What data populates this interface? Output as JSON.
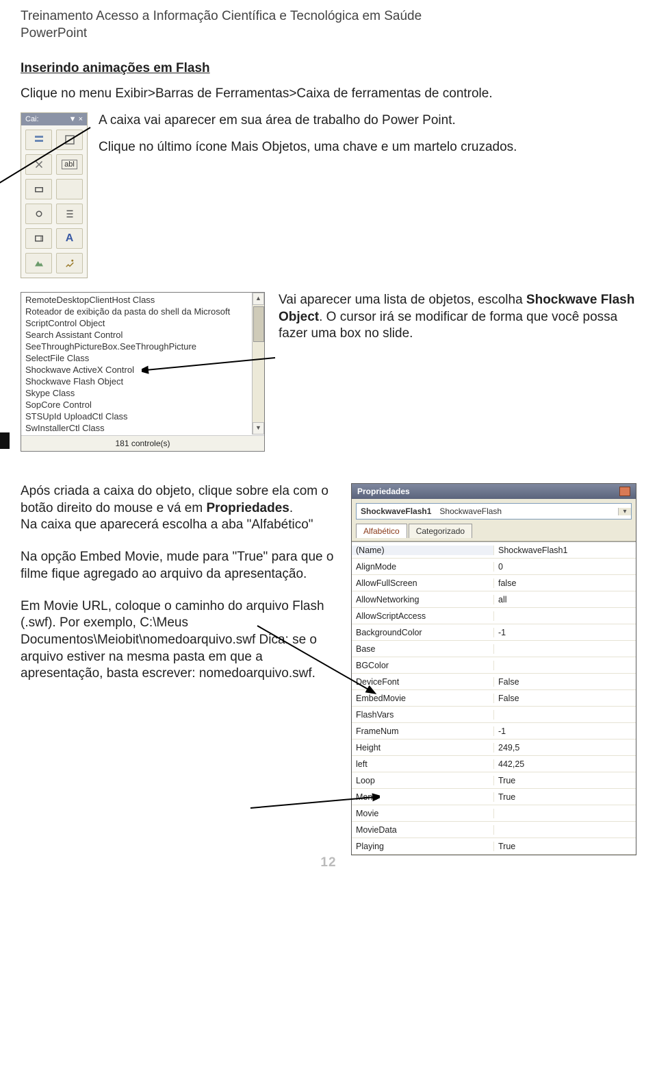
{
  "header": {
    "line1": "Treinamento Acesso a Informação Científica e Tecnológica em Saúde",
    "line2": "PowerPoint"
  },
  "section": {
    "heading": "Inserindo animações em Flash",
    "intro": "Clique no menu Exibir>Barras de Ferramentas>Caixa de ferramentas de controle.",
    "para1a": "A caixa vai aparecer em sua área de trabalho do Power Point.",
    "para1b": "Clique no último ícone Mais Objetos, uma chave e um martelo cruzados.",
    "note1_a": "Vai aparecer uma lista de objetos, escolha ",
    "note1_bold": "Shockwave Flash Object",
    "note1_b": ". O cursor irá se modificar de forma que você possa fazer uma box no slide."
  },
  "palette": {
    "title": "Cai:",
    "close": "×"
  },
  "controls": {
    "items": [
      "RemoteDesktopClientHost Class",
      "Roteador de exibição da pasta do shell da Microsoft",
      "ScriptControl Object",
      "Search Assistant Control",
      "SeeThroughPictureBox.SeeThroughPicture",
      "SelectFile Class",
      "Shockwave ActiveX Control",
      "Shockwave Flash Object",
      "Skype Class",
      "SopCore Control",
      "STSUpId UploadCtl Class",
      "SwInstallerCtl Class"
    ],
    "footer": "181 controle(s)"
  },
  "section2": {
    "p1_a": "Após criada a caixa do objeto, clique sobre ela com o botão direito do mouse e vá em ",
    "p1_bold": "Propriedades",
    "p1_b": ".",
    "p2": "Na caixa que aparecerá escolha a aba \"Alfabético\"",
    "p3": "Na opção Embed Movie, mude para \"True\" para que o filme fique agregado ao arquivo da apresentação.",
    "p4": "Em Movie URL, coloque o caminho do arquivo Flash (.swf). Por exemplo, C:\\Meus Documentos\\Meiobit\\nomedoarquivo.swf Dica: se o arquivo estiver na mesma pasta em que a apresentação, basta escrever: nomedoarquivo.swf."
  },
  "properties": {
    "title": "Propriedades",
    "selected_name": "ShockwaveFlash1",
    "selected_type": "ShockwaveFlash",
    "tabs": {
      "alpha": "Alfabético",
      "cat": "Categorizado"
    },
    "rows": [
      [
        "(Name)",
        "ShockwaveFlash1"
      ],
      [
        "AlignMode",
        "0"
      ],
      [
        "AllowFullScreen",
        "false"
      ],
      [
        "AllowNetworking",
        "all"
      ],
      [
        "AllowScriptAccess",
        ""
      ],
      [
        "BackgroundColor",
        "-1"
      ],
      [
        "Base",
        ""
      ],
      [
        "BGColor",
        ""
      ],
      [
        "DeviceFont",
        "False"
      ],
      [
        "EmbedMovie",
        "False"
      ],
      [
        "FlashVars",
        ""
      ],
      [
        "FrameNum",
        "-1"
      ],
      [
        "Height",
        "249,5"
      ],
      [
        "left",
        "442,25"
      ],
      [
        "Loop",
        "True"
      ],
      [
        "Menu",
        "True"
      ],
      [
        "Movie",
        ""
      ],
      [
        "MovieData",
        ""
      ],
      [
        "Playing",
        "True"
      ]
    ]
  },
  "pagenum": "12"
}
